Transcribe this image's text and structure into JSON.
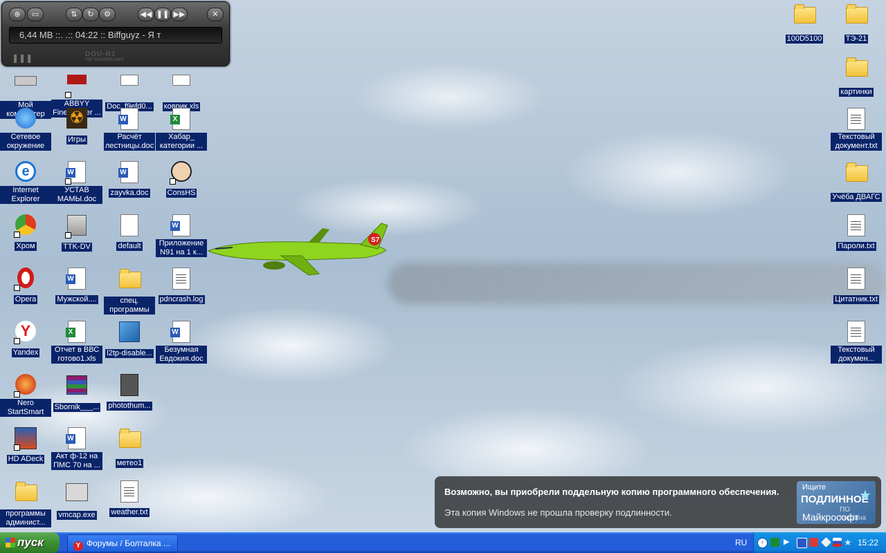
{
  "player": {
    "display_text": "6,44 MB ::.       .:: 04:22 :: Biffguyz - Я т",
    "brand": "DGU-R1",
    "brand_sub": "TSF DECIDER UNIT"
  },
  "desktop_icons": [
    {
      "label": "Мой компьютер"
    },
    {
      "label": "ABBYY FineReader ..."
    },
    {
      "label": "Doc_f9efd0..."
    },
    {
      "label": "коврик.xls"
    },
    {
      "label": "Сетевое окружение"
    },
    {
      "label": "Игры"
    },
    {
      "label": "Расчёт лестницы.doc"
    },
    {
      "label": "Хабар_ категории ..."
    },
    {
      "label": "Internet Explorer"
    },
    {
      "label": "УСТАВ МАМЫ.doc"
    },
    {
      "label": "zayvka.doc"
    },
    {
      "label": "ConsHS"
    },
    {
      "label": "Хром"
    },
    {
      "label": "TTK-DV"
    },
    {
      "label": "default"
    },
    {
      "label": "Приложение N91 на 1 к..."
    },
    {
      "label": "Opera"
    },
    {
      "label": "Мужской...."
    },
    {
      "label": "спец. программы"
    },
    {
      "label": "pdncrash.log"
    },
    {
      "label": "Yandex"
    },
    {
      "label": "Отчет в ВВС готово1.xls"
    },
    {
      "label": "l2tp-disable..."
    },
    {
      "label": "Безумная Евдокия.doc"
    },
    {
      "label": "Nero StartSmart"
    },
    {
      "label": "Sbornik___..."
    },
    {
      "label": "photothum..."
    },
    {
      "label": "HD ADeck"
    },
    {
      "label": "Акт ф-12 на ПМС 70 на ..."
    },
    {
      "label": "метео1"
    },
    {
      "label": "программы админист..."
    },
    {
      "label": "vmcap.exe"
    },
    {
      "label": "weather.txt"
    },
    {
      "label": "100D5100"
    },
    {
      "label": "ТЭ-21"
    },
    {
      "label": "картинки"
    },
    {
      "label": "Текстовый документ.txt"
    },
    {
      "label": "Учёба ДВАГС"
    },
    {
      "label": "Пароли.txt"
    },
    {
      "label": "Цитатник.txt"
    },
    {
      "label": "Текстовый докумен..."
    }
  ],
  "balloon": {
    "title": "Возможно, вы приобрели поддельную копию программного обеспечения.",
    "text": "Эта копия Windows не прошла проверку подлинности.",
    "genuine_line1": "Ищите",
    "genuine_line2": "ПОДЛИННОЕ",
    "genuine_line3": "ПО",
    "genuine_line4": "Майкрософт",
    "overlap_label": "Корзина"
  },
  "taskbar": {
    "start_label": "пуск",
    "task_button": "Форумы / Болталка ...",
    "language": "RU",
    "clock": "15:22"
  },
  "colors": {
    "taskbar_blue": "#245edb",
    "start_green": "#3c8f32",
    "label_highlight": "#0a246a"
  }
}
